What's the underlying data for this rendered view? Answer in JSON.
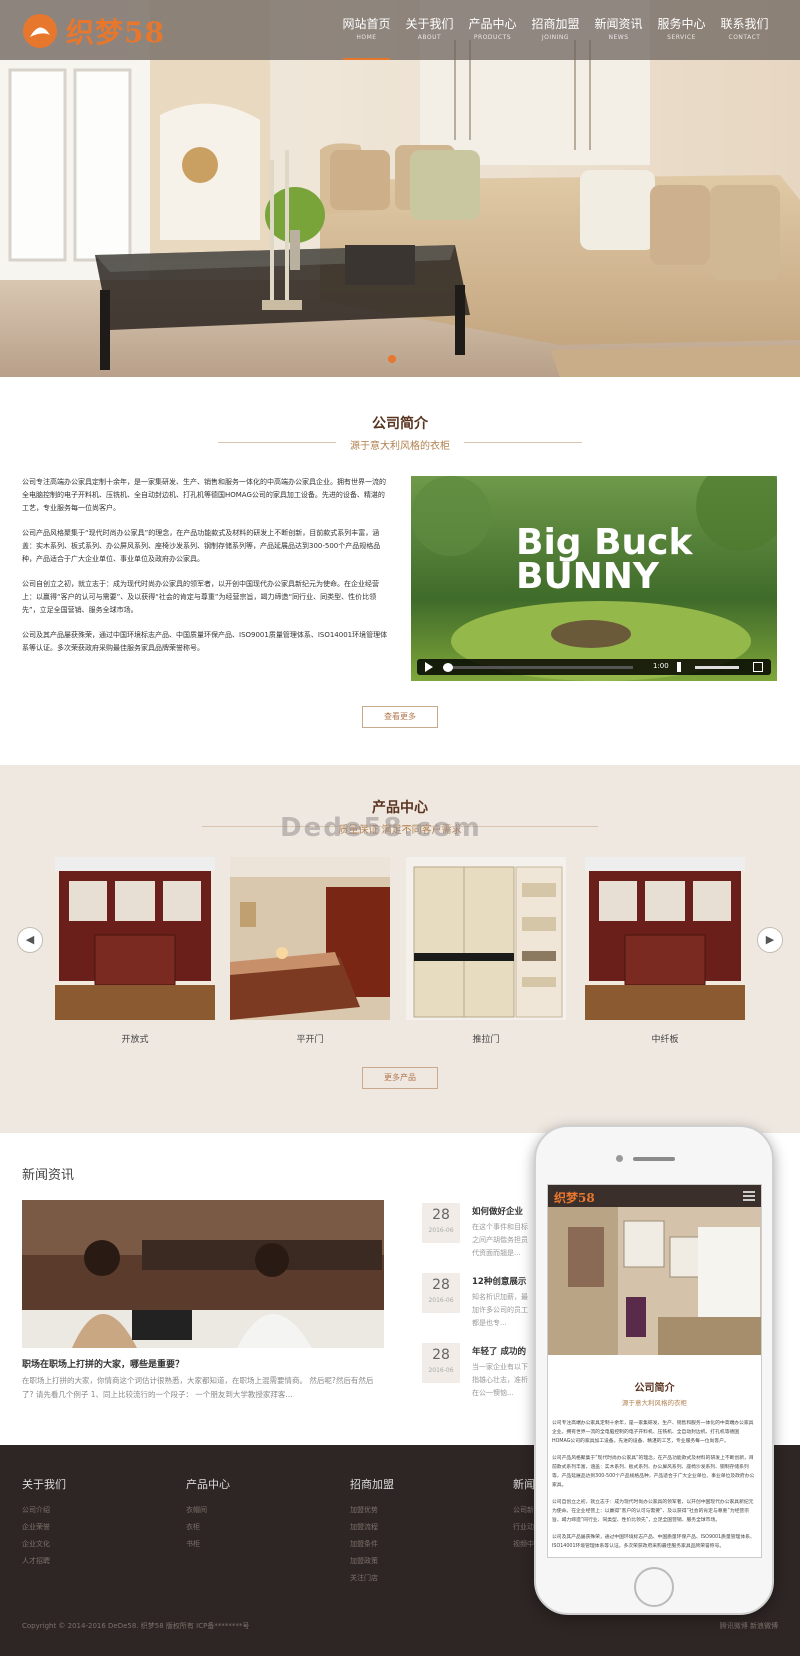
{
  "site": {
    "logo_text": "织梦58",
    "nav": [
      {
        "zh": "网站首页",
        "en": "HOME",
        "active": true
      },
      {
        "zh": "关于我们",
        "en": "ABOUT",
        "active": false
      },
      {
        "zh": "产品中心",
        "en": "PRODUCTS",
        "active": false
      },
      {
        "zh": "招商加盟",
        "en": "JOINING",
        "active": false
      },
      {
        "zh": "新闻资讯",
        "en": "NEWS",
        "active": false
      },
      {
        "zh": "服务中心",
        "en": "SERVICE",
        "active": false
      },
      {
        "zh": "联系我们",
        "en": "CONTACT",
        "active": false
      }
    ],
    "accent_color": "#e8772e"
  },
  "about": {
    "title": "公司简介",
    "subtitle": "源于意大利风格的衣柜",
    "paragraphs": [
      "公司专注高端办公家具定制十余年，是一家集研发、生产、销售和服务一体化的中高端办公家具企业。拥有世界一流的全电脑控制的电子开料机、压铣机、全自动封边机、打孔机等德国HOMAG公司的家具加工设备。先进的设备、精湛的工艺，专业服务每一位尚客户。",
      "公司产品风格聚集于“现代时尚办公家具”的理念，在产品功能款式及材料的研发上不断创新，目前款式系列丰富，涵盖：实木系列、板式系列、办公屏风系列、座椅沙发系列、钢制存储系列等，产品延展品达到300-500个产品规格品种，产品适合于广大企业单位、事业单位及政府办公家具。",
      "公司自创立之初，就立志于：成为现代时尚办公家具的领军者，以开创中国现代办公家具新纪元为使命。在企业经营上：以赢得“客户的认可与需要”、及以获得“社会的肯定与尊重”为经营宗旨，竭力缔造“同行业、同类型、性价比领先”，立足全国营销、服务全球市场。",
      "公司及其产品屡获殊荣，通过中国环境标志产品、中国质量环保产品、ISO9001质量管理体系、ISO14001环境管理体系等认证。多次荣获政府采购最佳服务家具品牌荣誉称号。"
    ],
    "video": {
      "title_line1": "Big Buck",
      "title_line2": "BUNNY",
      "time": "1:00"
    },
    "more_button": "查看更多"
  },
  "products": {
    "title": "产品中心",
    "subtitle": "质量保证 满足不同客户需求",
    "watermark": "Dede58.com",
    "items": [
      {
        "name": "开放式"
      },
      {
        "name": "平开门"
      },
      {
        "name": "推拉门"
      },
      {
        "name": "中纤板"
      }
    ],
    "more_button": "更多产品"
  },
  "news": {
    "heading": "新闻资讯",
    "main": {
      "title": "职场在职场上打拼的大家，哪些是重要？",
      "desc": "在职场上打拼的大家，你情商这个词估计很熟悉，大家都知道，在职场上混需要情商。 然后呢?然后有然后了? 请先看几个例子 1、同上比较流行的一个段子： 一个朋友到大学教授家拜客..."
    },
    "items": [
      {
        "day": "28",
        "ym": "2016-06",
        "title": "如何做好企业",
        "desc": "在这个事件和目标之间产胡偕务担员代资面而翘是..."
      },
      {
        "day": "28",
        "ym": "2016-06",
        "title": "12种创意展示",
        "desc": "知名析识加薪，最加许多公司的员工都是也专..."
      },
      {
        "day": "28",
        "ym": "2016-06",
        "title": "年轻了 成功的",
        "desc": "当一家企业有以下指雄心壮志，准析在公一懊恼..."
      }
    ]
  },
  "footer": {
    "cols": [
      {
        "title": "关于我们",
        "links": [
          "公司介绍",
          "企业荣誉",
          "企业文化",
          "人才招聘"
        ]
      },
      {
        "title": "产品中心",
        "links": [
          "衣帽间",
          "衣柜",
          "书柜"
        ]
      },
      {
        "title": "招商加盟",
        "links": [
          "加盟优势",
          "加盟流程",
          "加盟条件",
          "加盟政策",
          "关注门店"
        ]
      },
      {
        "title": "新闻资讯",
        "links": [
          "公司新闻",
          "行业动态",
          "视频中心"
        ]
      }
    ],
    "copyright": "Copyright © 2014-2016 DeDe58. 织梦58 版权所有   ICP备********号",
    "weibo": "腾讯微博   新浪微博"
  },
  "mobile": {
    "logo_text": "织梦58",
    "title": "公司简介",
    "subtitle": "源于意大利风格的衣柜"
  }
}
